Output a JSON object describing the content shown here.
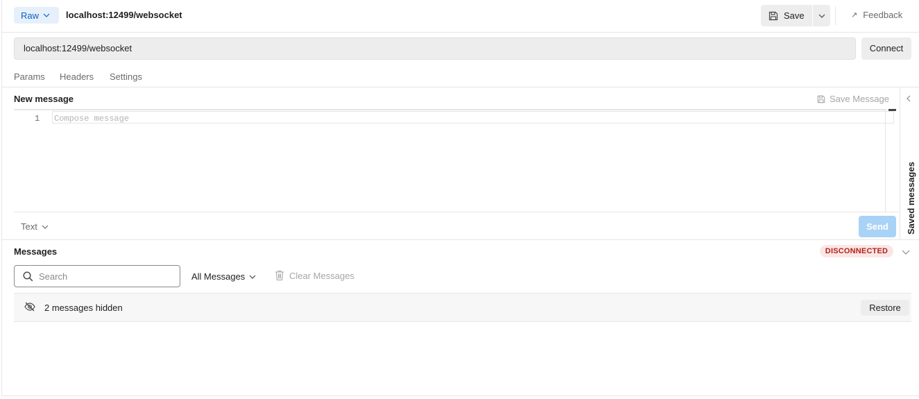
{
  "header": {
    "mode_label": "Raw",
    "request_title": "localhost:12499/websocket",
    "save_label": "Save",
    "feedback_label": "Feedback"
  },
  "url_bar": {
    "value": "localhost:12499/websocket",
    "connect_label": "Connect"
  },
  "tabs": [
    {
      "label": "Params"
    },
    {
      "label": "Headers"
    },
    {
      "label": "Settings"
    }
  ],
  "composer": {
    "title": "New message",
    "save_message_label": "Save Message",
    "line_number": "1",
    "placeholder": "Compose message",
    "format_label": "Text",
    "send_label": "Send",
    "side_panel_label": "Saved messages"
  },
  "messages": {
    "title": "Messages",
    "status": "DISCONNECTED",
    "search_placeholder": "Search",
    "filter_label": "All Messages",
    "clear_label": "Clear Messages",
    "hidden_text": "2 messages hidden",
    "restore_label": "Restore"
  },
  "colors": {
    "accent": "#0b61c4",
    "send_disabled": "#a9d2f7",
    "status_red": "#b0231b",
    "status_bg": "#fbe6e6"
  },
  "icons": [
    "chevron-down-icon",
    "save-icon",
    "arrow-up-right-icon",
    "chevron-left-icon",
    "search-icon",
    "trash-icon",
    "eye-off-icon"
  ]
}
